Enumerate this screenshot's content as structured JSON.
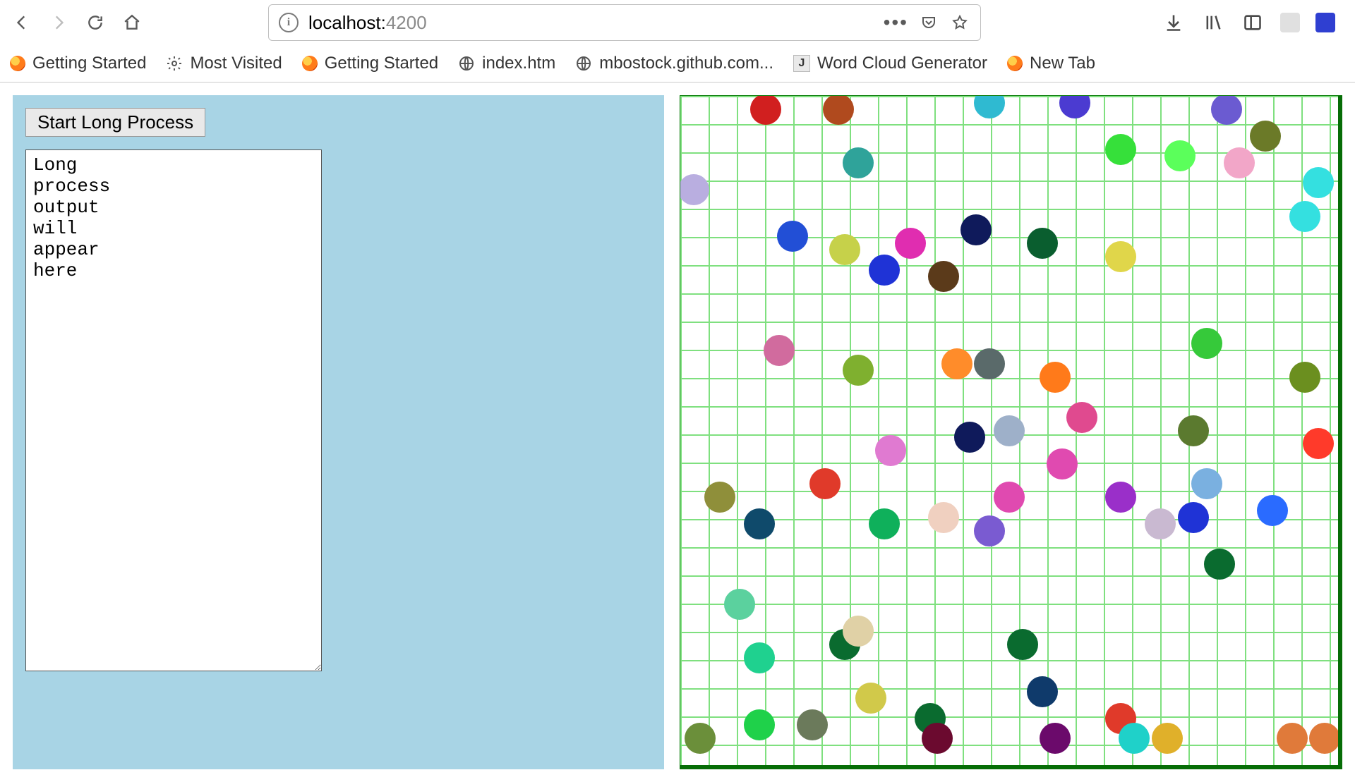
{
  "browser": {
    "url_host": "localhost:",
    "url_port": "4200",
    "bookmarks": [
      {
        "icon": "ff",
        "label": "Getting Started"
      },
      {
        "icon": "gear",
        "label": "Most Visited"
      },
      {
        "icon": "ff",
        "label": "Getting Started"
      },
      {
        "icon": "globe",
        "label": "index.htm"
      },
      {
        "icon": "globe",
        "label": "mbostock.github.com..."
      },
      {
        "icon": "sq",
        "sq_letter": "J",
        "label": "Word Cloud Generator"
      },
      {
        "icon": "ff",
        "label": "New Tab"
      }
    ]
  },
  "app": {
    "start_button_label": "Start Long Process",
    "output_text": "Long\nprocess\noutput\nwill\nappear\nhere"
  },
  "chart_data": {
    "type": "scatter",
    "title": "",
    "xlabel": "",
    "ylabel": "",
    "xlim": [
      0,
      100
    ],
    "ylim": [
      0,
      100
    ],
    "grid": true,
    "grid_color": "#7fe07f",
    "points": [
      {
        "x": 13,
        "y": 98,
        "color": "#d11f1f"
      },
      {
        "x": 24,
        "y": 98,
        "color": "#b04a1e"
      },
      {
        "x": 47,
        "y": 99,
        "color": "#2fbad1"
      },
      {
        "x": 60,
        "y": 99,
        "color": "#4b3bd1"
      },
      {
        "x": 83,
        "y": 98,
        "color": "#6b5bd1"
      },
      {
        "x": 89,
        "y": 94,
        "color": "#6b7a28"
      },
      {
        "x": 2,
        "y": 86,
        "color": "#b9aee0"
      },
      {
        "x": 27,
        "y": 90,
        "color": "#2fa39a"
      },
      {
        "x": 67,
        "y": 92,
        "color": "#36e03a"
      },
      {
        "x": 76,
        "y": 91,
        "color": "#5bff5b"
      },
      {
        "x": 85,
        "y": 90,
        "color": "#f2a6c8"
      },
      {
        "x": 97,
        "y": 87,
        "color": "#34e0e0"
      },
      {
        "x": 95,
        "y": 82,
        "color": "#34e0e0"
      },
      {
        "x": 17,
        "y": 79,
        "color": "#224fd6"
      },
      {
        "x": 25,
        "y": 77,
        "color": "#c6d14a"
      },
      {
        "x": 31,
        "y": 74,
        "color": "#1f33d6"
      },
      {
        "x": 35,
        "y": 78,
        "color": "#e02db0"
      },
      {
        "x": 40,
        "y": 73,
        "color": "#5b3a1a"
      },
      {
        "x": 45,
        "y": 80,
        "color": "#0f1a5b"
      },
      {
        "x": 55,
        "y": 78,
        "color": "#0a5e2f"
      },
      {
        "x": 67,
        "y": 76,
        "color": "#e0d64a"
      },
      {
        "x": 15,
        "y": 62,
        "color": "#d16b9e"
      },
      {
        "x": 27,
        "y": 59,
        "color": "#7fb02f"
      },
      {
        "x": 42,
        "y": 60,
        "color": "#ff8c2a"
      },
      {
        "x": 47,
        "y": 60,
        "color": "#5a6a6a"
      },
      {
        "x": 57,
        "y": 58,
        "color": "#ff7a1a"
      },
      {
        "x": 80,
        "y": 63,
        "color": "#36c93a"
      },
      {
        "x": 95,
        "y": 58,
        "color": "#6b8f1f"
      },
      {
        "x": 6,
        "y": 40,
        "color": "#8f8f3a"
      },
      {
        "x": 12,
        "y": 36,
        "color": "#0f4a6b"
      },
      {
        "x": 22,
        "y": 42,
        "color": "#e03a2a"
      },
      {
        "x": 32,
        "y": 47,
        "color": "#e07ad1"
      },
      {
        "x": 31,
        "y": 36,
        "color": "#0fb05b"
      },
      {
        "x": 40,
        "y": 37,
        "color": "#f0d0c0"
      },
      {
        "x": 44,
        "y": 49,
        "color": "#0f1a5b"
      },
      {
        "x": 47,
        "y": 35,
        "color": "#7a5bd1"
      },
      {
        "x": 50,
        "y": 50,
        "color": "#9eb0c9"
      },
      {
        "x": 50,
        "y": 40,
        "color": "#e04ab0"
      },
      {
        "x": 58,
        "y": 45,
        "color": "#e04ab0"
      },
      {
        "x": 61,
        "y": 52,
        "color": "#e04a8f"
      },
      {
        "x": 67,
        "y": 40,
        "color": "#9a2fc9"
      },
      {
        "x": 73,
        "y": 36,
        "color": "#c9b9d1"
      },
      {
        "x": 78,
        "y": 50,
        "color": "#5b7a2f"
      },
      {
        "x": 78,
        "y": 37,
        "color": "#1f33d6"
      },
      {
        "x": 80,
        "y": 42,
        "color": "#7ab0e0"
      },
      {
        "x": 90,
        "y": 38,
        "color": "#2a6bff"
      },
      {
        "x": 82,
        "y": 30,
        "color": "#0a6b2f"
      },
      {
        "x": 97,
        "y": 48,
        "color": "#ff3a2a"
      },
      {
        "x": 9,
        "y": 24,
        "color": "#5bd19e"
      },
      {
        "x": 12,
        "y": 16,
        "color": "#1fd18f"
      },
      {
        "x": 25,
        "y": 18,
        "color": "#0a6b2f"
      },
      {
        "x": 29,
        "y": 10,
        "color": "#d1c94a"
      },
      {
        "x": 12,
        "y": 6,
        "color": "#1fd14a"
      },
      {
        "x": 3,
        "y": 4,
        "color": "#6b8f3a"
      },
      {
        "x": 20,
        "y": 6,
        "color": "#6b7a5b"
      },
      {
        "x": 27,
        "y": 20,
        "color": "#e0d1a6"
      },
      {
        "x": 38,
        "y": 7,
        "color": "#0a6b2f"
      },
      {
        "x": 39,
        "y": 4,
        "color": "#6b0a2f"
      },
      {
        "x": 52,
        "y": 18,
        "color": "#0a6b2f"
      },
      {
        "x": 55,
        "y": 11,
        "color": "#0f3a6b"
      },
      {
        "x": 57,
        "y": 4,
        "color": "#6b0a6b"
      },
      {
        "x": 67,
        "y": 7,
        "color": "#e03a2a"
      },
      {
        "x": 69,
        "y": 4,
        "color": "#1fd1c9"
      },
      {
        "x": 74,
        "y": 4,
        "color": "#e0b02a"
      },
      {
        "x": 93,
        "y": 4,
        "color": "#e07a3a"
      },
      {
        "x": 98,
        "y": 4,
        "color": "#e07a3a"
      }
    ]
  }
}
